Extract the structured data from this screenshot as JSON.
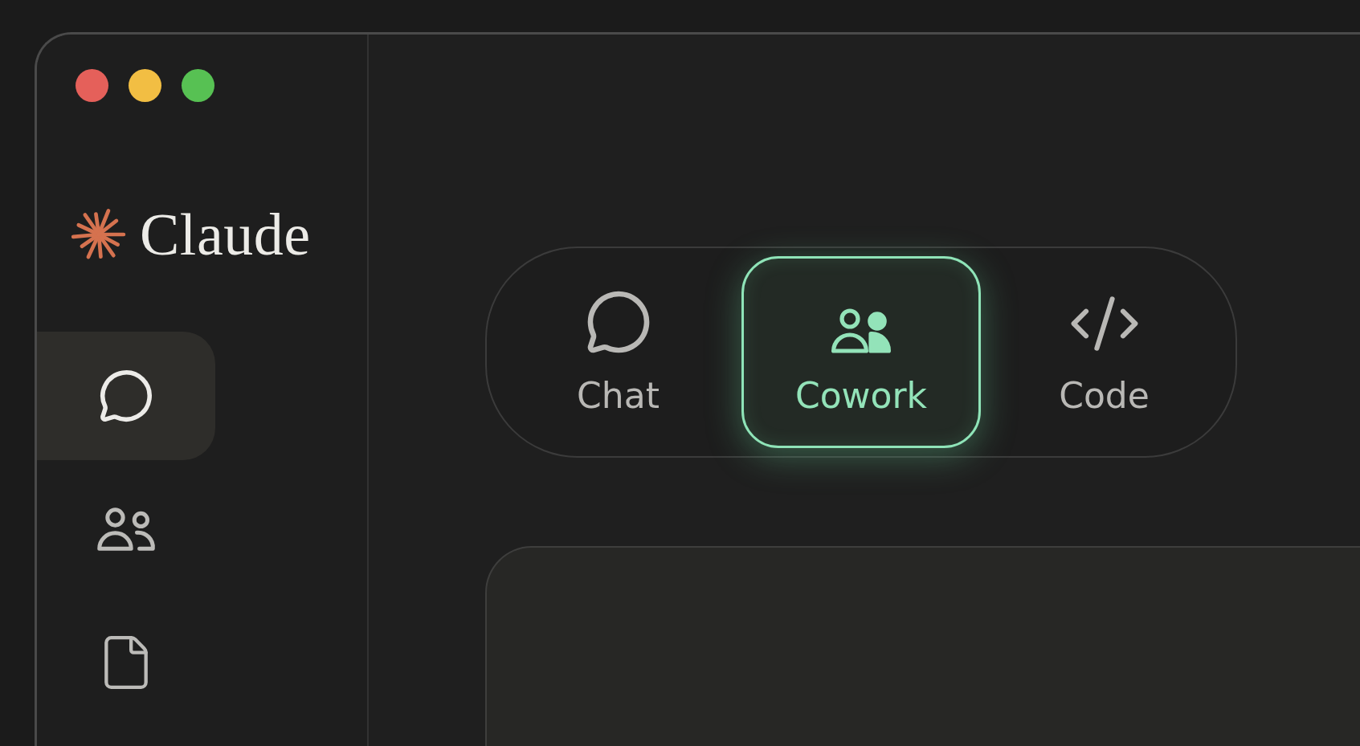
{
  "window": {
    "traffic_lights": [
      {
        "color": "#e5605a"
      },
      {
        "color": "#f2be43"
      },
      {
        "color": "#57c153"
      }
    ]
  },
  "sidebar": {
    "brand": "Claude",
    "items": [
      {
        "kind": "chat",
        "selected": true
      },
      {
        "kind": "people",
        "selected": false
      },
      {
        "kind": "file",
        "selected": false
      }
    ]
  },
  "mode_switch": {
    "tabs": [
      {
        "kind": "chat",
        "label": "Chat",
        "selected": false
      },
      {
        "kind": "people",
        "label": "Cowork",
        "selected": true
      },
      {
        "kind": "code",
        "label": "Code",
        "selected": false
      }
    ]
  }
}
